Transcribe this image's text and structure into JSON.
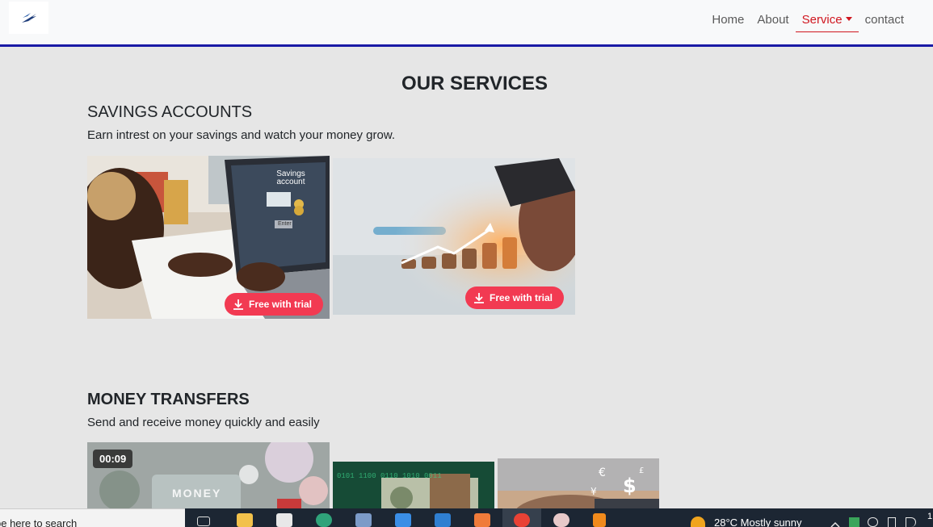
{
  "nav": {
    "links": [
      {
        "label": "Home"
      },
      {
        "label": "About"
      },
      {
        "label": "Service"
      },
      {
        "label": "contact"
      }
    ]
  },
  "page": {
    "title": "OUR SERVICES"
  },
  "sections": [
    {
      "heading": "SAVINGS ACCOUNTS",
      "description": "Earn intrest on your savings and watch your money grow.",
      "images": [
        {
          "icon": "savings-laptop-photo",
          "screen_title": "Savings account",
          "screen_button": "Enter",
          "button": "Free with trial"
        },
        {
          "icon": "coins-growth-photo",
          "button": "Free with trial"
        }
      ]
    },
    {
      "heading": "MONEY TRANSFERS",
      "description": "Send and receive money quickly and easily",
      "images": [
        {
          "icon": "money-transfer-video",
          "duration": "00:09",
          "overlay": "MONEY"
        },
        {
          "icon": "cash-stack-photo"
        },
        {
          "icon": "currency-hands-photo"
        }
      ]
    }
  ],
  "taskbar": {
    "search_placeholder": "pe here to search",
    "weather": "28°C  Mostly sunny",
    "clock": "1"
  },
  "colors": {
    "accent": "#d0161f",
    "nav_border": "#1a1aa6",
    "trial_button": "#f23a52",
    "background": "#e6e6e6"
  }
}
